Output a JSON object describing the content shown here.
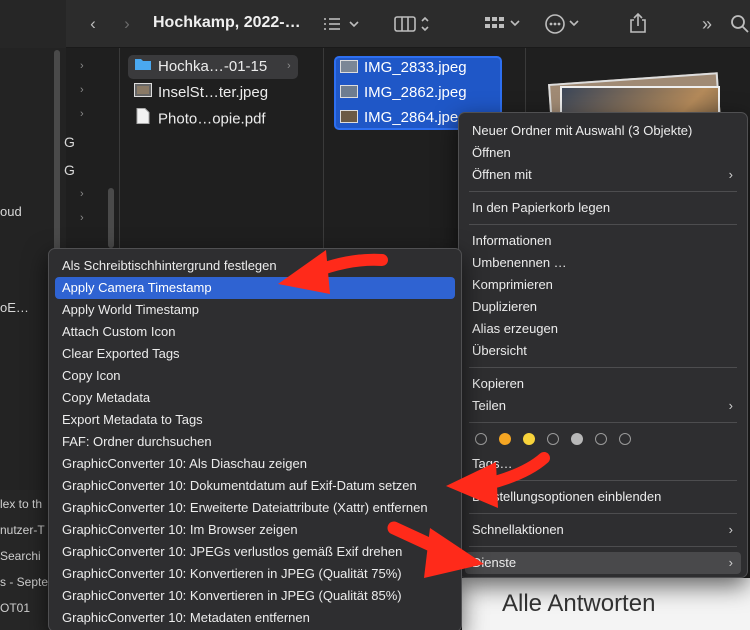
{
  "toolbar": {
    "title": "Hochkamp, 2022-…",
    "back_icon": "chevron-left-icon",
    "forward_icon": "chevron-right-icon"
  },
  "sidebar": {
    "fragments": [
      "oud",
      "oE…"
    ],
    "col_letters": [
      "G",
      "G"
    ]
  },
  "column2": {
    "items": [
      {
        "label": "Hochka…-01-15",
        "icon": "folder-icon"
      },
      {
        "label": "InselSt…ter.jpeg",
        "icon": "image-file-icon"
      },
      {
        "label": "Photo…opie.pdf",
        "icon": "pdf-file-icon"
      }
    ]
  },
  "column3": {
    "items": [
      "IMG_2833.jpeg",
      "IMG_2862.jpeg",
      "IMG_2864.jpeg"
    ]
  },
  "bg_list_fragments": [
    "lex to th",
    "nutzer-T",
    "Searchi",
    "s - Septe",
    "OT01"
  ],
  "preview_text": "Alle Antworten",
  "context_menu": {
    "group1": [
      "Neuer Ordner mit Auswahl (3 Objekte)",
      "Öffnen",
      "Öffnen mit"
    ],
    "group2": [
      "In den Papierkorb legen"
    ],
    "group3": [
      "Informationen",
      "Umbenennen …",
      "Komprimieren",
      "Duplizieren",
      "Alias erzeugen",
      "Übersicht"
    ],
    "group4": [
      "Kopieren",
      "Teilen"
    ],
    "tags_label": "Tags…",
    "view_options": "Darstellungsoptionen einblenden",
    "quick_actions": "Schnellaktionen",
    "services": "Dienste",
    "tag_colors": [
      "",
      "#f5a623",
      "#f8d33b",
      "",
      "#b8b8b8",
      "",
      ""
    ]
  },
  "services_menu": {
    "items": [
      "Als Schreibtischhintergrund festlegen",
      "Apply Camera Timestamp",
      "Apply World Timestamp",
      "Attach Custom Icon",
      "Clear Exported Tags",
      "Copy Icon",
      "Copy Metadata",
      "Export Metadata to Tags",
      "FAF: Ordner durchsuchen",
      "GraphicConverter 10: Als Diaschau zeigen",
      "GraphicConverter 10: Dokumentdatum auf Exif-Datum setzen",
      "GraphicConverter 10: Erweiterte Dateiattribute (Xattr) entfernen",
      "GraphicConverter 10: Im Browser zeigen",
      "GraphicConverter 10: JPEGs verlustlos gemäß Exif drehen",
      "GraphicConverter 10: Konvertieren in JPEG (Qualität 75%)",
      "GraphicConverter 10: Konvertieren in JPEG (Qualität 85%)",
      "GraphicConverter 10: Metadaten entfernen"
    ],
    "highlighted_index": 1
  },
  "colors": {
    "selection": "#2f63d2",
    "annotation_arrow": "#ff2a1a"
  }
}
